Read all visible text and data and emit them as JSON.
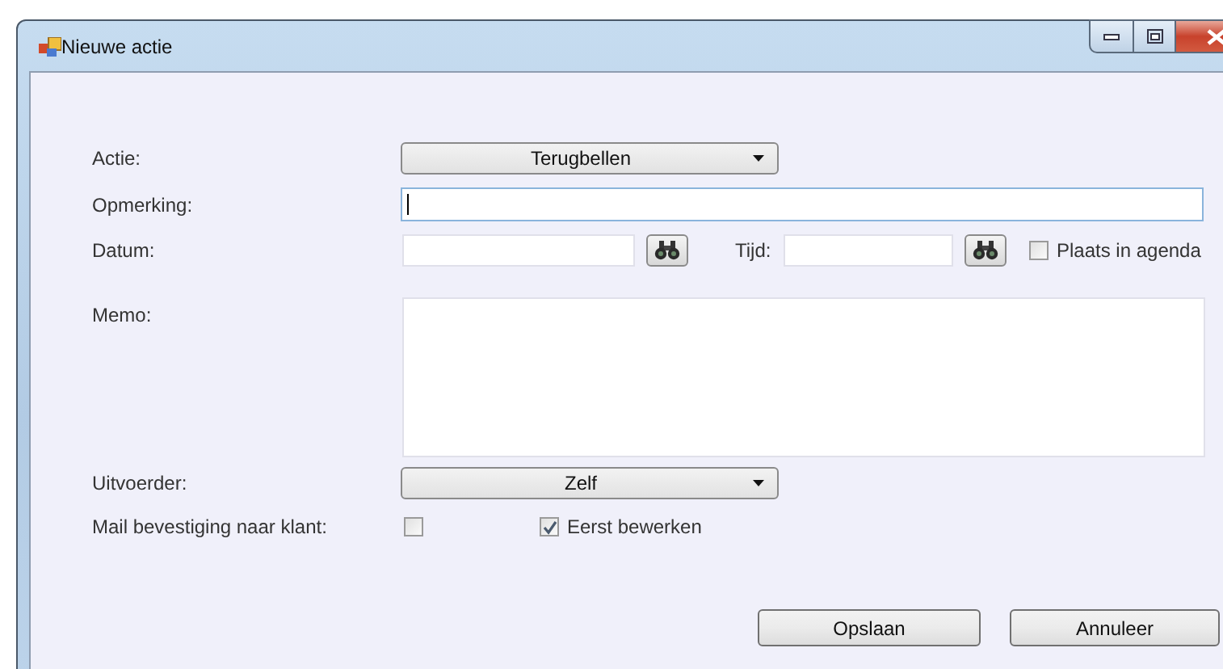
{
  "window": {
    "title": "Nieuwe actie"
  },
  "actie": {
    "label": "Actie:",
    "value": "Terugbellen"
  },
  "opmerking": {
    "label": "Opmerking:",
    "focused": true
  },
  "datum": {
    "label": "Datum:"
  },
  "tijd": {
    "label": "Tijd:"
  },
  "plaats_in_agenda": {
    "label": "Plaats in agenda",
    "checked": false
  },
  "memo": {
    "label": "Memo:"
  },
  "uitvoerder": {
    "label": "Uitvoerder:",
    "value": "Zelf"
  },
  "mail_bevestiging": {
    "label": "Mail bevestiging naar klant:",
    "checked": false
  },
  "eerst_bewerken": {
    "label": "Eerst bewerken",
    "checked": true
  },
  "buttons": [
    "Opslaan",
    "Annuleer"
  ]
}
